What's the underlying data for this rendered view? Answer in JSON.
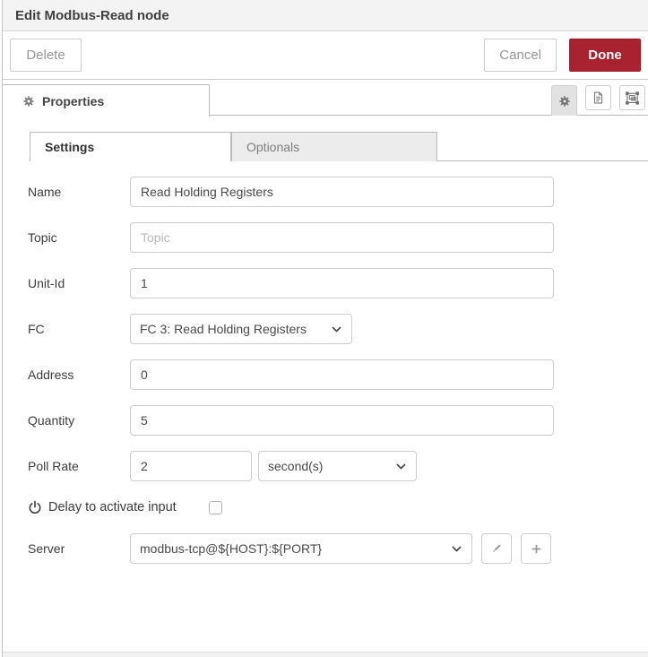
{
  "dialog": {
    "title": "Edit Modbus-Read node"
  },
  "toolbar": {
    "delete_label": "Delete",
    "cancel_label": "Cancel",
    "done_label": "Done"
  },
  "properties_tab": {
    "label": "Properties"
  },
  "subtabs": {
    "settings_label": "Settings",
    "optionals_label": "Optionals",
    "active": "Settings"
  },
  "form": {
    "name": {
      "label": "Name",
      "value": "Read Holding Registers"
    },
    "topic": {
      "label": "Topic",
      "placeholder": "Topic",
      "value": ""
    },
    "unit_id": {
      "label": "Unit-Id",
      "value": "1"
    },
    "fc": {
      "label": "FC",
      "value": "FC 3: Read Holding Registers"
    },
    "address": {
      "label": "Address",
      "value": "0"
    },
    "quantity": {
      "label": "Quantity",
      "value": "5"
    },
    "poll_rate": {
      "label": "Poll Rate",
      "value": "2",
      "unit_value": "second(s)"
    },
    "delay": {
      "label": "Delay to activate input",
      "checked": false
    },
    "server": {
      "label": "Server",
      "value": "modbus-tcp@${HOST}:${PORT}"
    }
  },
  "icons": {
    "properties": "gear-icon",
    "toolbar_right": [
      "gear-icon",
      "document-icon",
      "object-group-icon"
    ],
    "delay": "power-icon",
    "server_buttons": [
      "pencil-icon",
      "plus-icon"
    ]
  },
  "colors": {
    "accent_red": "#a8222f",
    "header_bg": "#f3f3f3",
    "inactive_tab_bg": "#ececec"
  }
}
